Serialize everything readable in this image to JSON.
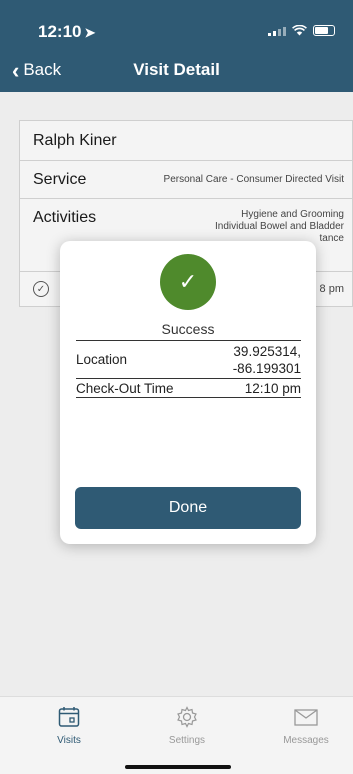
{
  "status_bar": {
    "time": "12:10",
    "location_arrow": "➤"
  },
  "nav": {
    "back_label": "Back",
    "title": "Visit Detail"
  },
  "detail": {
    "client_name": "Ralph Kiner",
    "service_label": "Service",
    "service_value": "Personal Care - Consumer Directed Visit",
    "activities_label": "Activities",
    "activities_values": [
      "Hygiene and Grooming",
      "Individual Bowel and Bladder",
      "tance"
    ],
    "visit_partial_time": "8 pm"
  },
  "modal": {
    "status": "Success",
    "location_label": "Location",
    "location_lat": "39.925314,",
    "location_lng": "-86.199301",
    "checkout_label": "Check-Out Time",
    "checkout_value": "12:10 pm",
    "done_label": "Done",
    "badge_color": "#4f8a2c"
  },
  "tabs": [
    {
      "label": "Visits",
      "icon": "calendar-icon",
      "active": true
    },
    {
      "label": "Settings",
      "icon": "gear-icon",
      "active": false
    },
    {
      "label": "Messages",
      "icon": "envelope-icon",
      "active": false
    }
  ],
  "colors": {
    "brand": "#2f5a74",
    "success": "#4f8a2c"
  }
}
